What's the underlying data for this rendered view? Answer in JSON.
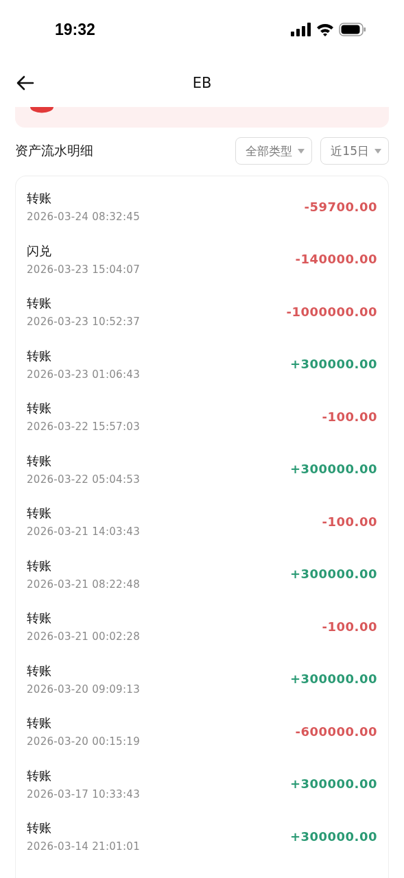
{
  "status_bar": {
    "time": "19:32"
  },
  "header": {
    "title": "EB"
  },
  "section": {
    "title": "资产流水明细",
    "filters": [
      {
        "label": "全部类型"
      },
      {
        "label": "近15日"
      }
    ]
  },
  "transactions": [
    {
      "title": "转账",
      "time": "2026-03-24 08:32:45",
      "amount": "-59700.00",
      "kind": "debit"
    },
    {
      "title": "闪兑",
      "time": "2026-03-23 15:04:07",
      "amount": "-140000.00",
      "kind": "debit"
    },
    {
      "title": "转账",
      "time": "2026-03-23 10:52:37",
      "amount": "-1000000.00",
      "kind": "debit"
    },
    {
      "title": "转账",
      "time": "2026-03-23 01:06:43",
      "amount": "+300000.00",
      "kind": "credit"
    },
    {
      "title": "转账",
      "time": "2026-03-22 15:57:03",
      "amount": "-100.00",
      "kind": "debit"
    },
    {
      "title": "转账",
      "time": "2026-03-22 05:04:53",
      "amount": "+300000.00",
      "kind": "credit"
    },
    {
      "title": "转账",
      "time": "2026-03-21 14:03:43",
      "amount": "-100.00",
      "kind": "debit"
    },
    {
      "title": "转账",
      "time": "2026-03-21 08:22:48",
      "amount": "+300000.00",
      "kind": "credit"
    },
    {
      "title": "转账",
      "time": "2026-03-21 00:02:28",
      "amount": "-100.00",
      "kind": "debit"
    },
    {
      "title": "转账",
      "time": "2026-03-20 09:09:13",
      "amount": "+300000.00",
      "kind": "credit"
    },
    {
      "title": "转账",
      "time": "2026-03-20 00:15:19",
      "amount": "-600000.00",
      "kind": "debit"
    },
    {
      "title": "转账",
      "time": "2026-03-17 10:33:43",
      "amount": "+300000.00",
      "kind": "credit"
    },
    {
      "title": "转账",
      "time": "2026-03-14 21:01:01",
      "amount": "+300000.00",
      "kind": "credit"
    }
  ]
}
